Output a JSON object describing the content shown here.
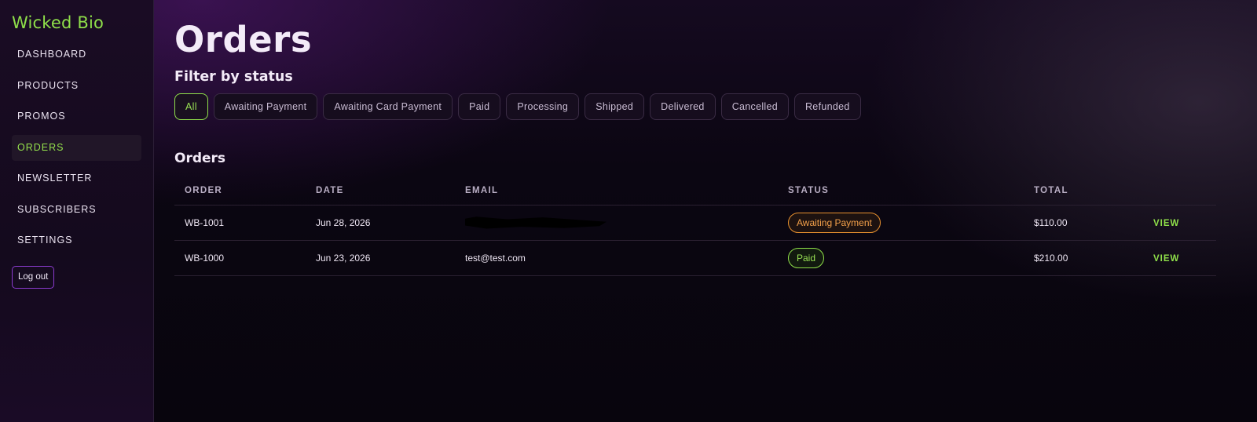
{
  "sidebar": {
    "brand": "Wicked Bio",
    "items": [
      {
        "label": "DASHBOARD"
      },
      {
        "label": "PRODUCTS"
      },
      {
        "label": "PROMOS"
      },
      {
        "label": "ORDERS"
      },
      {
        "label": "NEWSLETTER"
      },
      {
        "label": "SUBSCRIBERS"
      },
      {
        "label": "SETTINGS"
      }
    ],
    "active_item": "ORDERS",
    "logout_label": "Log out"
  },
  "main": {
    "title": "Orders",
    "filter_heading": "Filter by status",
    "filters": [
      {
        "label": "All"
      },
      {
        "label": "Awaiting Payment"
      },
      {
        "label": "Awaiting Card Payment"
      },
      {
        "label": "Paid"
      },
      {
        "label": "Processing"
      },
      {
        "label": "Shipped"
      },
      {
        "label": "Delivered"
      },
      {
        "label": "Cancelled"
      },
      {
        "label": "Refunded"
      }
    ],
    "active_filter": "All",
    "section_title": "Orders",
    "table": {
      "headers": [
        "ORDER",
        "DATE",
        "EMAIL",
        "STATUS",
        "TOTAL",
        ""
      ],
      "rows": [
        {
          "order": "WB-1001",
          "date": "Jun 28, 2026",
          "email": "",
          "email_redacted": true,
          "status": "Awaiting Payment",
          "total": "$110.00",
          "action": "VIEW"
        },
        {
          "order": "WB-1000",
          "date": "Jun 23, 2026",
          "email": "test@test.com",
          "email_redacted": false,
          "status": "Paid",
          "total": "$210.00",
          "action": "VIEW"
        }
      ]
    }
  },
  "colors": {
    "accent_green": "#8fe04a",
    "accent_purple": "#8b3bd0",
    "status_awaiting": "#e8912f",
    "status_paid": "#8fe04a",
    "background": "#0a0610"
  }
}
